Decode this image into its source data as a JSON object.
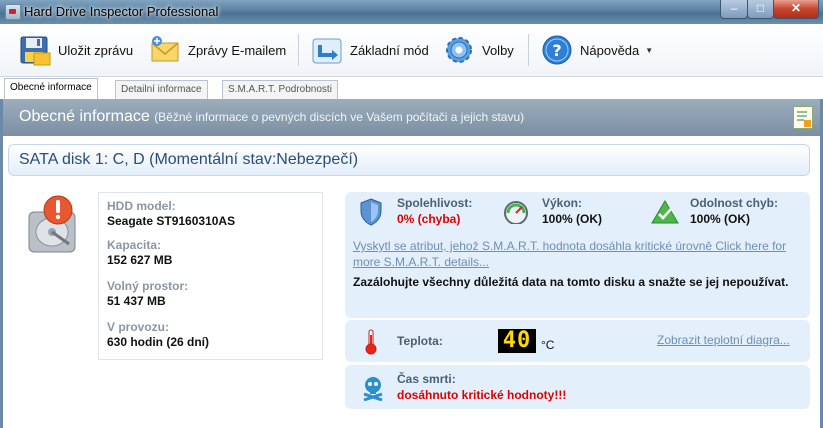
{
  "window": {
    "title": "Hard Drive Inspector Professional"
  },
  "toolbar": {
    "items": [
      {
        "label": "Uložit zprávu",
        "icon": "floppy-disk-icon"
      },
      {
        "label": "Zprávy E-mailem",
        "icon": "envelope-icon"
      },
      {
        "label": "Základní mód",
        "icon": "arrow-return-icon"
      },
      {
        "label": "Volby",
        "icon": "gear-icon"
      },
      {
        "label": "Nápověda",
        "icon": "help-icon"
      }
    ]
  },
  "tabs": [
    {
      "label": "Obecné informace",
      "active": true
    },
    {
      "label": "Detailní informace",
      "active": false
    },
    {
      "label": "S.M.A.R.T. Podrobnosti",
      "active": false
    }
  ],
  "header": {
    "title": "Obecné informace",
    "subtitle": "(Běžné informace o pevných discích ve Vašem počítači a jejich stavu)"
  },
  "disk": {
    "heading": "SATA disk 1: C, D (Momentální stav:Nebezpečí)",
    "model_label": "HDD model:",
    "model_value": "Seagate ST9160310AS",
    "capacity_label": "Kapacita:",
    "capacity_value": "152 627 MB",
    "free_label": "Volný prostor:",
    "free_value": "51 437 MB",
    "uptime_label": "V provozu:",
    "uptime_value": "630 hodin (26 dní)"
  },
  "status": {
    "reliability_label": "Spolehlivost:",
    "reliability_value": "0% (chyba)",
    "performance_label": "Výkon:",
    "performance_value": "100% (OK)",
    "fault_tolerance_label": "Odolnost chyb:",
    "fault_tolerance_value": "100% (OK)",
    "smart_link": "Vyskytl se atribut, jehož S.M.A.R.T. hodnota dosáhla kritické úrovně Click here for more S.M.A.R.T. details...",
    "warning": "Zazálohujte všechny důležitá data na tomto disku a snažte se jej nepoužívat.",
    "temperature_label": "Teplota:",
    "temperature_value": "40",
    "temperature_unit": "°C",
    "temperature_link": "Zobrazit teplotní diagra...",
    "death_label": "Čas smrti:",
    "death_value": "dosáhnuto kritické hodnoty!!!"
  },
  "colors": {
    "danger": "#e00000",
    "accent": "#2a4d7a",
    "panel": "#e3effa"
  }
}
